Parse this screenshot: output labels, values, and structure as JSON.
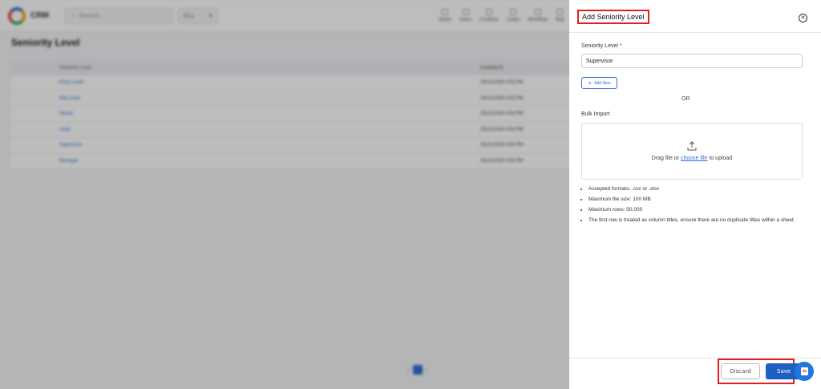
{
  "background": {
    "brand": {
      "line1": "",
      "line2": "CRM"
    },
    "search_placeholder": "Search...",
    "scope_value": "ALL",
    "nav": [
      "Home",
      "Users",
      "Contacts",
      "Leads",
      "Workflow",
      "Rep"
    ],
    "page_title": "Seniority Level",
    "table": {
      "headers": [
        "",
        "Seniority Level",
        "Created At"
      ],
      "rows": [
        {
          "name": "Entry Level",
          "created": "25/11/2025 4:53 PM"
        },
        {
          "name": "Mid Level",
          "created": "25/11/2025 4:53 PM"
        },
        {
          "name": "Senior",
          "created": "25/11/2025 4:53 PM"
        },
        {
          "name": "Lead",
          "created": "25/11/2025 4:53 PM"
        },
        {
          "name": "Supervisor",
          "created": "25/11/2025 4:53 PM"
        },
        {
          "name": "Manager",
          "created": "25/11/2025 4:53 PM"
        }
      ]
    },
    "footer": {
      "range": "",
      "page": "1"
    }
  },
  "drawer": {
    "title": "Add Seniority Level",
    "field_label": "Seniority Level",
    "required_mark": "*",
    "field_value": "Supervisor",
    "add_new_label": "Add New",
    "or_label": "OR",
    "bulk_label": "Bulk Import",
    "drop_prefix": "Drag file or",
    "drop_link": "choose file",
    "drop_suffix": "to upload",
    "rules": [
      "Accepted formats: .csv or .xlsx",
      "Maximum file size: 100 MB",
      "Maximum rows: 50,000",
      "The first row is treated as column titles, ensure there are no duplicate titles within a sheet."
    ],
    "discard_label": "Discard",
    "save_label": "Save"
  },
  "colors": {
    "accent": "#1f5fc4",
    "highlight": "#e02020"
  }
}
